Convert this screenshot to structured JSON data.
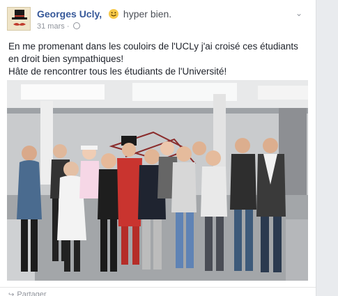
{
  "post": {
    "author": "Georges Ucly,",
    "feeling": "hyper bien.",
    "date": "31 mars",
    "dot": "·",
    "body_line1": "En me promenant dans les couloirs de l'UCLy j'ai croisé ces étudiants en droit bien sympathiques!",
    "body_line2": "Hâte de rencontrer tous les étudiants de l'Université!"
  },
  "footer": {
    "share_label": "Partager"
  },
  "icons": {
    "feeling": "smiley-icon",
    "privacy": "globe-icon",
    "menu": "chevron-down-icon",
    "share": "share-arrow-icon"
  },
  "colors": {
    "author": "#365899",
    "text": "#1d2129",
    "meta": "#90949c",
    "background": "#e9ebee"
  }
}
